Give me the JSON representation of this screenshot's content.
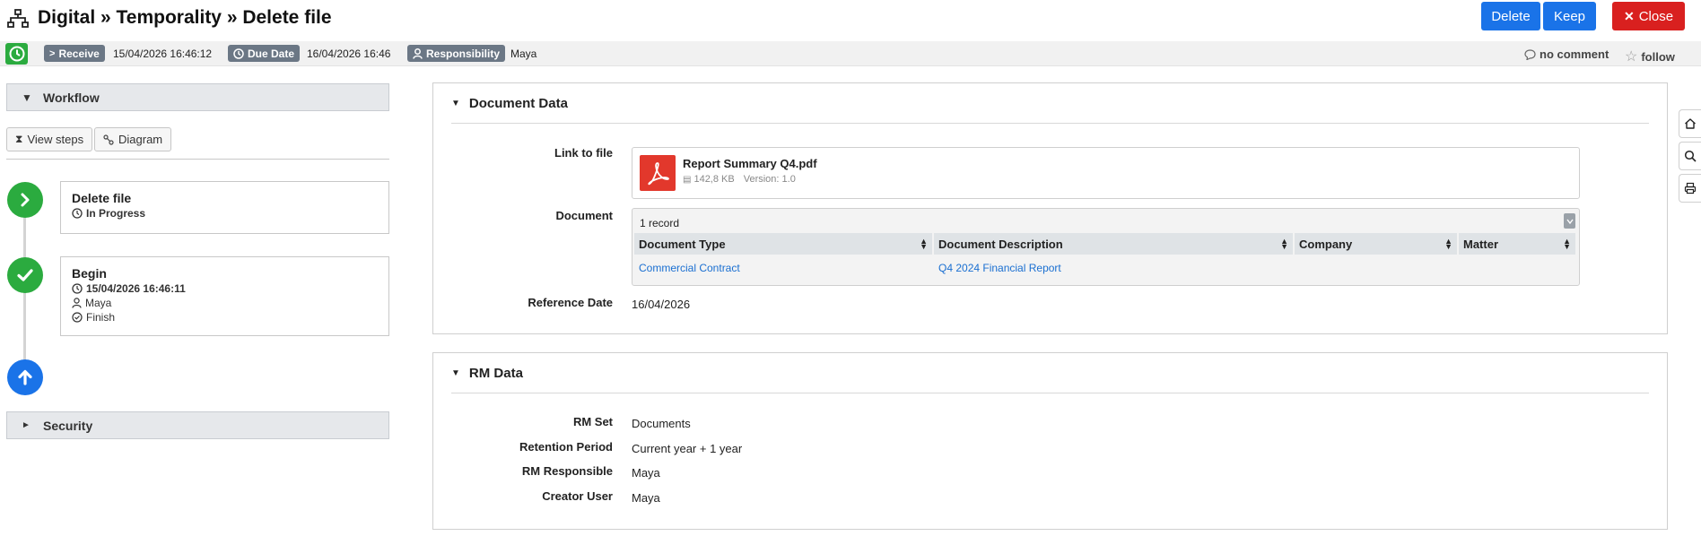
{
  "header": {
    "title": "Digital » Temporality » Delete file",
    "app_icon": "sitemap-icon",
    "buttons": {
      "delete": "Delete",
      "keep": "Keep",
      "close": "Close"
    }
  },
  "status": {
    "receive_label": "Receive",
    "receive_value": "15/04/2026 16:46:12",
    "due_label": "Due Date",
    "due_value": "16/04/2026 16:46",
    "responsibility_label": "Responsibility",
    "responsibility_value": "Maya",
    "comment": "no comment",
    "follow": "follow"
  },
  "workflow": {
    "title": "Workflow",
    "view_steps": "View steps",
    "diagram": "Diagram",
    "steps": [
      {
        "title": "Delete file",
        "status": "In Progress",
        "icon": "chevron-right-icon",
        "color": "#2bab3f"
      },
      {
        "title": "Begin",
        "date": "15/04/2026 16:46:11",
        "user": "Maya",
        "result": "Finish",
        "icon": "check-icon",
        "color": "#2bab3f"
      }
    ],
    "start_icon": "arrow-up-icon",
    "start_color": "#1a73e8"
  },
  "security": {
    "title": "Security"
  },
  "document_data": {
    "title": "Document Data",
    "link_label": "Link to file",
    "file": {
      "name": "Report Summary Q4.pdf",
      "size": "142,8 KB",
      "version": "Version: 1.0"
    },
    "document_label": "Document",
    "grid": {
      "count": "1 record",
      "columns": [
        "Document Type",
        "Document Description",
        "Company",
        "Matter"
      ],
      "rows": [
        [
          "Commercial Contract",
          "Q4 2024 Financial Report",
          "",
          ""
        ]
      ]
    },
    "reference_label": "Reference Date",
    "reference_value": "16/04/2026"
  },
  "rm_data": {
    "title": "RM Data",
    "fields": [
      {
        "label": "RM Set",
        "value": "Documents"
      },
      {
        "label": "Retention Period",
        "value": "Current year + 1 year"
      },
      {
        "label": "RM Responsible",
        "value": "Maya"
      },
      {
        "label": "Creator User",
        "value": "Maya"
      }
    ]
  },
  "side_tools": [
    "home-icon",
    "search-icon",
    "print-icon"
  ]
}
